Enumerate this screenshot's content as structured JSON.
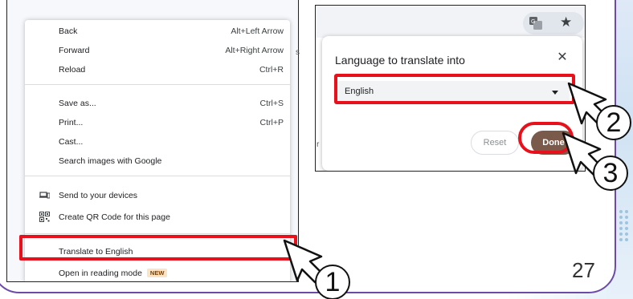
{
  "context_menu": {
    "items": [
      {
        "label": "Back",
        "shortcut": "Alt+Left Arrow"
      },
      {
        "label": "Forward",
        "shortcut": "Alt+Right Arrow"
      },
      {
        "label": "Reload",
        "shortcut": "Ctrl+R"
      },
      {
        "label": "Save as...",
        "shortcut": "Ctrl+S"
      },
      {
        "label": "Print...",
        "shortcut": "Ctrl+P"
      },
      {
        "label": "Cast...",
        "shortcut": ""
      },
      {
        "label": "Search images with Google",
        "shortcut": ""
      },
      {
        "label": "Send to your devices",
        "shortcut": "",
        "icon": "devices-icon"
      },
      {
        "label": "Create QR Code for this page",
        "shortcut": "",
        "icon": "qr-code-icon"
      },
      {
        "label": "Translate to English",
        "shortcut": ""
      },
      {
        "label": "Open in reading mode",
        "shortcut": "",
        "badge": "NEW"
      }
    ]
  },
  "translate_popup": {
    "title": "Language to translate into",
    "close_glyph": "✕",
    "selected_language": "English",
    "reset_label": "Reset",
    "done_label": "Done"
  },
  "toolbar_icons": [
    "translate-icon",
    "bookmark-star-icon"
  ],
  "step_markers": [
    "1",
    "2",
    "3"
  ],
  "page_number": "27",
  "stray_marks": {
    "slash": "s",
    "edge_r": "r"
  },
  "colors": {
    "highlight": "#e8101a",
    "done_button": "#7a5a4b",
    "frame_border": "#6b4aa8"
  }
}
